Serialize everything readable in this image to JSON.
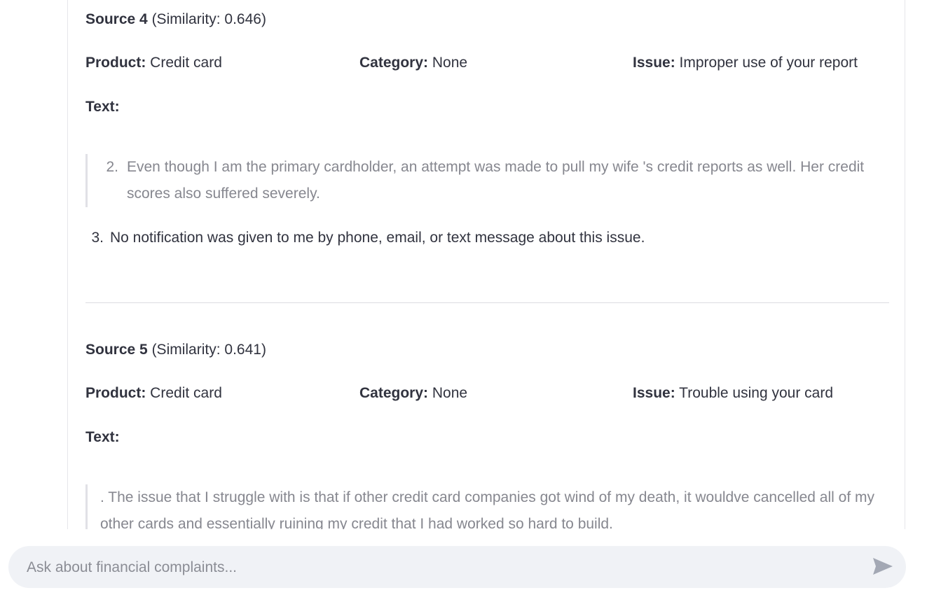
{
  "sources": [
    {
      "label": "Source 4",
      "similarity": "(Similarity: 0.646)",
      "product_label": "Product:",
      "product_value": "Credit card",
      "category_label": "Category:",
      "category_value": "None",
      "issue_label": "Issue:",
      "issue_value": "Improper use of your report",
      "text_label": "Text:",
      "quote_item_number": "2.",
      "quote_item_text": "Even though I am the primary cardholder, an attempt was made to pull my wife 's credit reports as well. Her credit scores also suffered severely.",
      "list_item_number": "3.",
      "list_item_text": "No notification was given to me by phone, email, or text message about this issue."
    },
    {
      "label": "Source 5",
      "similarity": "(Similarity: 0.641)",
      "product_label": "Product:",
      "product_value": "Credit card",
      "category_label": "Category:",
      "category_value": "None",
      "issue_label": "Issue:",
      "issue_value": "Trouble using your card",
      "text_label": "Text:",
      "quote_text": ". The issue that I struggle with is that if other credit card companies got wind of my death, it wouldve cancelled all of my other cards and essentially ruining my credit that I had worked so hard to build."
    }
  ],
  "chat": {
    "placeholder": "Ask about financial complaints...",
    "send_icon": "send-arrow-icon"
  },
  "colors": {
    "text": "#31333f",
    "muted_text": "#86878f",
    "input_bg": "#f0f2f6",
    "send_icon": "#a3a8b4"
  }
}
